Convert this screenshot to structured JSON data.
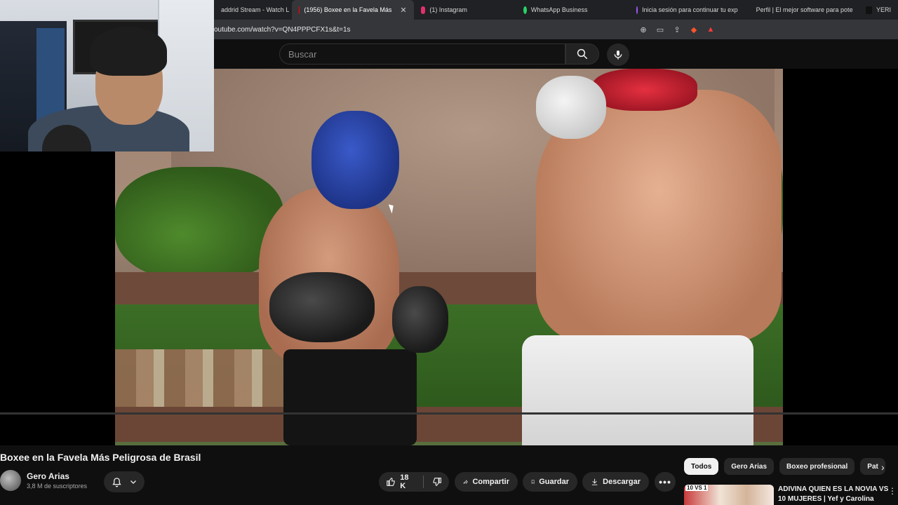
{
  "browser": {
    "tabs": [
      {
        "label": "addrid Stream - Watch L",
        "active": false,
        "favicon_color": "#444"
      },
      {
        "label": "(1956) Boxee en la Favela Más",
        "active": true,
        "favicon_color": "#ff0000"
      },
      {
        "label": "(1) Instagram",
        "active": false,
        "favicon_color": "#e1306c"
      },
      {
        "label": "WhatsApp Business",
        "active": false,
        "favicon_color": "#25d366"
      },
      {
        "label": "Inicia sesión para continuar tu exp",
        "active": false,
        "favicon_color": "#a259ff"
      },
      {
        "label": "Perfil | El mejor software para pote",
        "active": false,
        "favicon_color": "#ffffff"
      },
      {
        "label": "YERI",
        "active": false,
        "favicon_color": "#111111"
      }
    ],
    "url": "outube.com/watch?v=QN4PPPCFX1s&t=1s"
  },
  "masthead": {
    "search_placeholder": "Buscar"
  },
  "video": {
    "title": "Boxee en la Favela Más Peligrosa de Brasil"
  },
  "channel": {
    "name": "Gero Arias",
    "subscribers": "3,8 M de suscriptores"
  },
  "actions": {
    "likes": "18 K",
    "share": "Compartir",
    "save": "Guardar",
    "download": "Descargar"
  },
  "chips": [
    "Todos",
    "Gero Arias",
    "Boxeo profesional",
    "Pat"
  ],
  "recommendation": {
    "thumb_badge": "10 VS 1",
    "title": "ADIVINA QUIEN ES LA NOVIA VS 10 MUJERES | Yef y Carolina"
  },
  "colors": {
    "accent": "#ff0000",
    "background": "#0f0f0f"
  }
}
